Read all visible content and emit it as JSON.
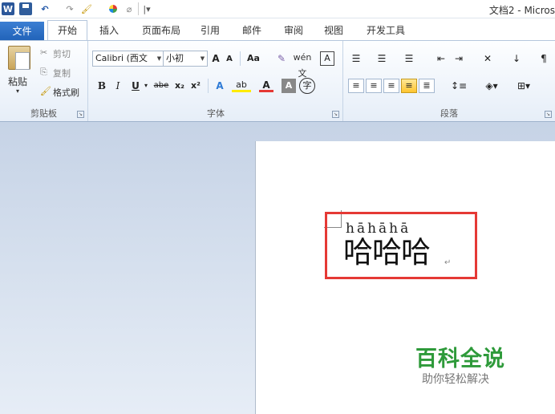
{
  "window": {
    "title": "文档2 - Micros"
  },
  "qat": {
    "app_icon": "W",
    "undo": "↶",
    "redo": "↷",
    "more": "|▾"
  },
  "tabs": [
    "文件",
    "开始",
    "插入",
    "页面布局",
    "引用",
    "邮件",
    "审阅",
    "视图",
    "开发工具"
  ],
  "ribbon": {
    "clipboard": {
      "label": "剪贴板",
      "paste": "粘贴",
      "cut": "剪切",
      "copy": "复制",
      "format_painter": "格式刷"
    },
    "font": {
      "label": "字体",
      "font_name": "Calibri (西文",
      "font_size": "小初",
      "grow": "A",
      "shrink": "A",
      "case": "Aa",
      "clear": "✎",
      "phonetic": "wén 文",
      "border_char": "A",
      "bold": "B",
      "italic": "I",
      "underline": "U",
      "strike": "abe",
      "sub": "x₂",
      "sup": "x²",
      "effects": "A",
      "highlight": "ab",
      "color": "A",
      "shading": "A",
      "enclose": "字"
    },
    "paragraph": {
      "label": "段落"
    }
  },
  "document": {
    "pinyin": "hāhāhā",
    "text": "哈哈哈",
    "para_mark": "↵"
  },
  "watermark": {
    "brand": "百科全说",
    "sub": "助你轻松解决"
  },
  "colors": {
    "accent": "#2b579a",
    "file_tab": "#2b6cc4",
    "highlight_box": "#e53935",
    "watermark": "#2e9a3a"
  }
}
